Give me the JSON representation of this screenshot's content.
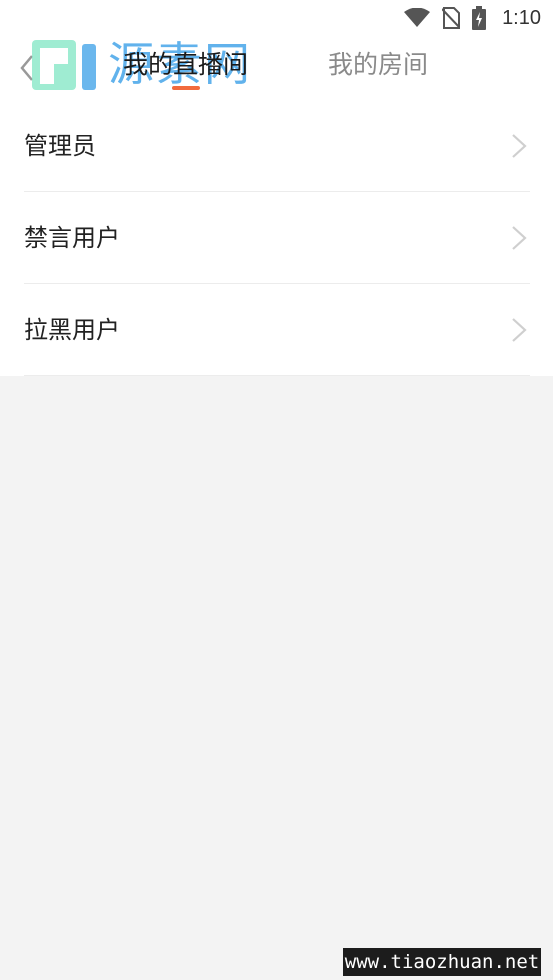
{
  "status_bar": {
    "time": "1:10"
  },
  "header": {
    "tabs": [
      {
        "label": "我的直播间",
        "active": true
      },
      {
        "label": "我的房间",
        "active": false
      }
    ],
    "accent_color": "#f26a3d"
  },
  "watermark": {
    "logo_text": "源素网",
    "site": "www.tiaozhuan.net"
  },
  "menu": {
    "items": [
      {
        "label": "管理员"
      },
      {
        "label": "禁言用户"
      },
      {
        "label": "拉黑用户"
      }
    ]
  },
  "icons": [
    "wifi-icon",
    "no-sim-icon",
    "battery-charging-icon",
    "back-arrow-icon",
    "chevron-right-icon"
  ]
}
